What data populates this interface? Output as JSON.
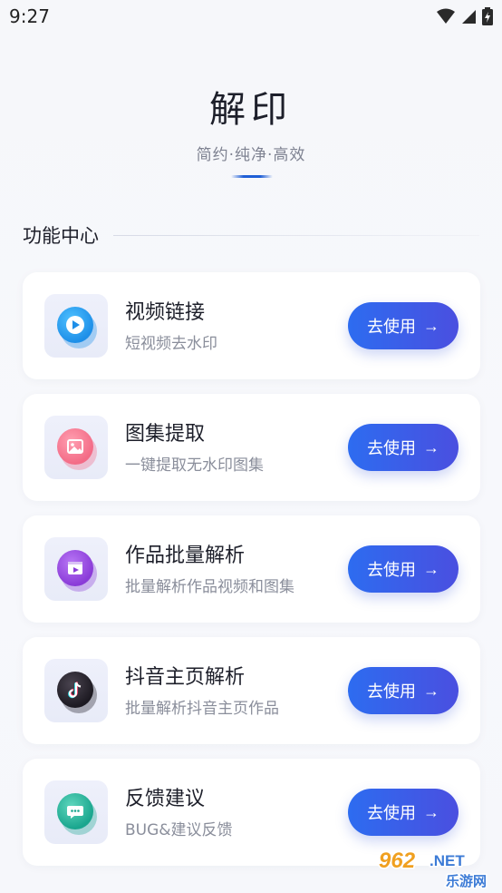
{
  "status_bar": {
    "time": "9:27"
  },
  "hero": {
    "title": "解印",
    "subtitle": "简约·纯净·高效"
  },
  "section": {
    "title": "功能中心"
  },
  "features": [
    {
      "title": "视频链接",
      "desc": "短视频去水印",
      "button": "去使用",
      "arrow": "→",
      "icon": "video-play-icon",
      "color": "#1e8fe8"
    },
    {
      "title": "图集提取",
      "desc": "一键提取无水印图集",
      "button": "去使用",
      "arrow": "→",
      "icon": "image-icon",
      "color": "#f36b86"
    },
    {
      "title": "作品批量解析",
      "desc": "批量解析作品视频和图集",
      "button": "去使用",
      "arrow": "→",
      "icon": "film-icon",
      "color": "#8a3bd8"
    },
    {
      "title": "抖音主页解析",
      "desc": "批量解析抖音主页作品",
      "button": "去使用",
      "arrow": "→",
      "icon": "tiktok-icon",
      "color": "#1d1a22"
    },
    {
      "title": "反馈建议",
      "desc": "BUG&建议反馈",
      "button": "去使用",
      "arrow": "→",
      "icon": "chat-bubble-icon",
      "color": "#1aa68e"
    }
  ],
  "watermark": {
    "top": "962.NET",
    "bottom": "乐游网"
  }
}
